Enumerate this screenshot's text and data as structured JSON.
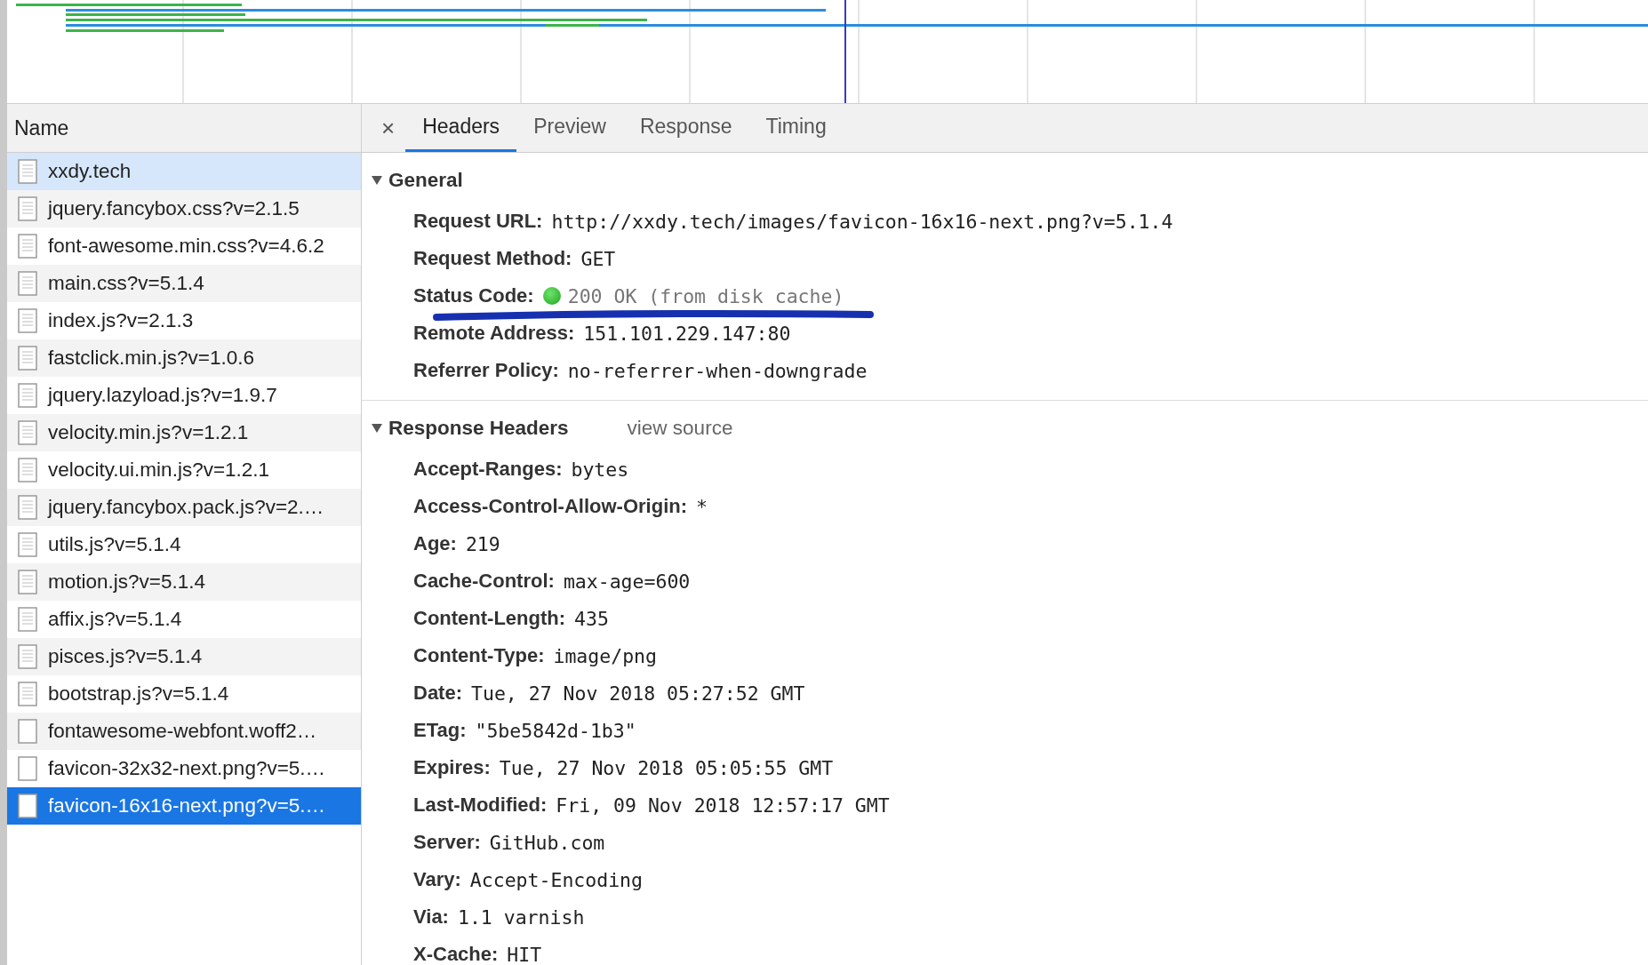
{
  "requests": {
    "column": "Name",
    "items": [
      {
        "name": "xxdy.tech",
        "kind": "doc",
        "highlighted": true,
        "selected": false
      },
      {
        "name": "jquery.fancybox.css?v=2.1.5",
        "kind": "doc",
        "highlighted": false,
        "selected": false
      },
      {
        "name": "font-awesome.min.css?v=4.6.2",
        "kind": "doc",
        "highlighted": false,
        "selected": false
      },
      {
        "name": "main.css?v=5.1.4",
        "kind": "doc",
        "highlighted": false,
        "selected": false
      },
      {
        "name": "index.js?v=2.1.3",
        "kind": "doc",
        "highlighted": false,
        "selected": false
      },
      {
        "name": "fastclick.min.js?v=1.0.6",
        "kind": "doc",
        "highlighted": false,
        "selected": false
      },
      {
        "name": "jquery.lazyload.js?v=1.9.7",
        "kind": "doc",
        "highlighted": false,
        "selected": false
      },
      {
        "name": "velocity.min.js?v=1.2.1",
        "kind": "doc",
        "highlighted": false,
        "selected": false
      },
      {
        "name": "velocity.ui.min.js?v=1.2.1",
        "kind": "doc",
        "highlighted": false,
        "selected": false
      },
      {
        "name": "jquery.fancybox.pack.js?v=2.…",
        "kind": "doc",
        "highlighted": false,
        "selected": false
      },
      {
        "name": "utils.js?v=5.1.4",
        "kind": "doc",
        "highlighted": false,
        "selected": false
      },
      {
        "name": "motion.js?v=5.1.4",
        "kind": "doc",
        "highlighted": false,
        "selected": false
      },
      {
        "name": "affix.js?v=5.1.4",
        "kind": "doc",
        "highlighted": false,
        "selected": false
      },
      {
        "name": "pisces.js?v=5.1.4",
        "kind": "doc",
        "highlighted": false,
        "selected": false
      },
      {
        "name": "bootstrap.js?v=5.1.4",
        "kind": "doc",
        "highlighted": false,
        "selected": false
      },
      {
        "name": "fontawesome-webfont.woff2…",
        "kind": "blank",
        "highlighted": false,
        "selected": false
      },
      {
        "name": "favicon-32x32-next.png?v=5.…",
        "kind": "blank",
        "highlighted": false,
        "selected": false
      },
      {
        "name": "favicon-16x16-next.png?v=5.…",
        "kind": "blank",
        "highlighted": false,
        "selected": true
      }
    ]
  },
  "details": {
    "close": "×",
    "tabs": [
      {
        "label": "Headers",
        "selected": true
      },
      {
        "label": "Preview",
        "selected": false
      },
      {
        "label": "Response",
        "selected": false
      },
      {
        "label": "Timing",
        "selected": false
      }
    ],
    "general": {
      "title": "General",
      "expanded": true,
      "rows": [
        {
          "kind": "text",
          "label": "Request URL:",
          "value": "http://xxdy.tech/images/favicon-16x16-next.png?v=5.1.4"
        },
        {
          "kind": "text",
          "label": "Request Method:",
          "value": "GET"
        },
        {
          "kind": "status",
          "label": "Status Code:",
          "value": "200 OK (from disk cache)"
        },
        {
          "kind": "text",
          "label": "Remote Address:",
          "value": "151.101.229.147:80"
        },
        {
          "kind": "text",
          "label": "Referrer Policy:",
          "value": "no-referrer-when-downgrade"
        }
      ]
    },
    "response_headers": {
      "title": "Response Headers",
      "expanded": true,
      "link": "view source",
      "rows": [
        {
          "label": "Accept-Ranges:",
          "value": "bytes"
        },
        {
          "label": "Access-Control-Allow-Origin:",
          "value": "*"
        },
        {
          "label": "Age:",
          "value": "219"
        },
        {
          "label": "Cache-Control:",
          "value": "max-age=600"
        },
        {
          "label": "Content-Length:",
          "value": "435"
        },
        {
          "label": "Content-Type:",
          "value": "image/png"
        },
        {
          "label": "Date:",
          "value": "Tue, 27 Nov 2018 05:27:52 GMT"
        },
        {
          "label": "ETag:",
          "value": "\"5be5842d-1b3\""
        },
        {
          "label": "Expires:",
          "value": "Tue, 27 Nov 2018 05:05:55 GMT"
        },
        {
          "label": "Last-Modified:",
          "value": "Fri, 09 Nov 2018 12:57:17 GMT"
        },
        {
          "label": "Server:",
          "value": "GitHub.com"
        },
        {
          "label": "Vary:",
          "value": "Accept-Encoding"
        },
        {
          "label": "Via:",
          "value": "1.1 varnish"
        },
        {
          "label": "X-Cache:",
          "value": "HIT"
        }
      ]
    }
  },
  "annotation": {
    "kind": "marker-underline"
  }
}
